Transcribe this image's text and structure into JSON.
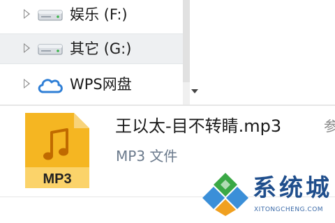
{
  "nav": {
    "items": [
      {
        "label": "娱乐 (F:)",
        "icon": "drive-icon",
        "selected": false
      },
      {
        "label": "其它 (G:)",
        "icon": "drive-icon",
        "selected": true
      },
      {
        "label": "WPS网盘",
        "icon": "cloud-icon",
        "selected": false
      }
    ]
  },
  "details": {
    "icon_label": "MP3",
    "file_name": "王以太-目不转睛.mp3",
    "file_type": "MP3 文件",
    "truncated_text": "参"
  },
  "watermark": {
    "title": "系统城",
    "url": "XITONGCHENG.COM"
  },
  "colors": {
    "accent_blue": "#1f4e8c",
    "mp3_orange": "#f5b622",
    "selected_bg": "#eef0f2"
  }
}
